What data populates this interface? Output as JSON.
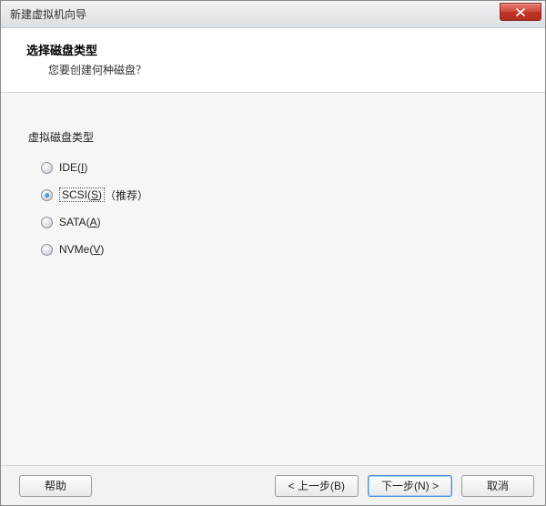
{
  "titlebar": {
    "title": "新建虚拟机向导"
  },
  "header": {
    "title": "选择磁盘类型",
    "subtitle": "您要创建何种磁盘？"
  },
  "group": {
    "label": "虚拟磁盘类型"
  },
  "options": {
    "ide": {
      "name": "IDE",
      "hotkey": "I",
      "suffix": ""
    },
    "scsi": {
      "name": "SCSI",
      "hotkey": "S",
      "suffix": " （推荐）"
    },
    "sata": {
      "name": "SATA",
      "hotkey": "A",
      "suffix": ""
    },
    "nvme": {
      "name": "NVMe",
      "hotkey": "V",
      "suffix": ""
    }
  },
  "buttons": {
    "help": "帮助",
    "back": "< 上一步(B)",
    "next": "下一步(N) >",
    "cancel": "取消"
  }
}
